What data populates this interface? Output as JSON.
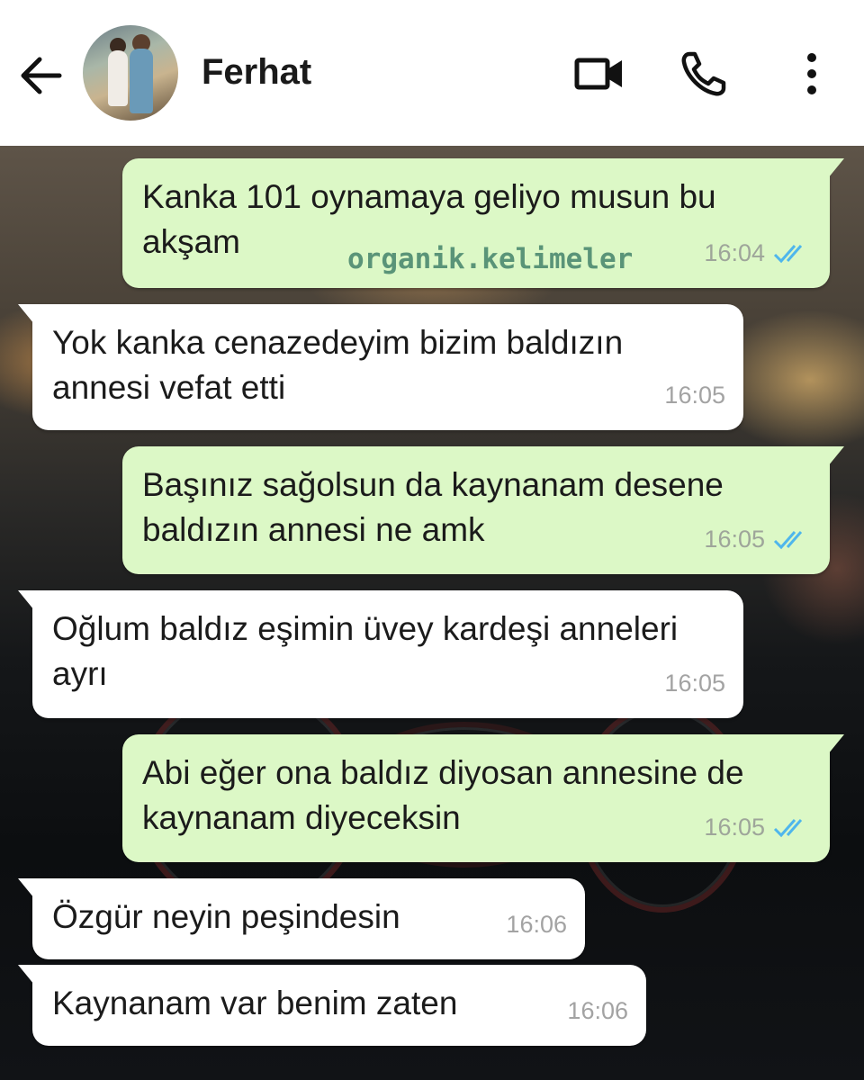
{
  "header": {
    "contact_name": "Ferhat",
    "icons": [
      "back-arrow-icon",
      "avatar",
      "video-call-icon",
      "phone-icon",
      "more-vert-icon"
    ]
  },
  "colors": {
    "outgoing_bubble": "#dcf8c6",
    "incoming_bubble": "#ffffff",
    "read_ticks": "#4fb6ec"
  },
  "watermark": "organik.kelimeler",
  "messages": [
    {
      "direction": "out",
      "text": "Kanka 101 oynamaya geliyo musun bu akşam",
      "time": "16:04",
      "status": "read"
    },
    {
      "direction": "in",
      "text": "Yok kanka cenazedeyim bizim baldızın annesi vefat etti",
      "time": "16:05"
    },
    {
      "direction": "out",
      "text": "Başınız sağolsun da kaynanam desene baldızın annesi ne amk",
      "time": "16:05",
      "status": "read"
    },
    {
      "direction": "in",
      "text": "Oğlum baldız eşimin üvey kardeşi anneleri ayrı",
      "time": "16:05"
    },
    {
      "direction": "out",
      "text": "Abi eğer ona baldız diyosan annesine de kaynanam diyeceksin",
      "time": "16:05",
      "status": "read"
    },
    {
      "direction": "in",
      "text": "Özgür neyin peşindesin",
      "time": "16:06"
    },
    {
      "direction": "in",
      "text": "Kaynanam var benim zaten",
      "time": "16:06"
    }
  ]
}
